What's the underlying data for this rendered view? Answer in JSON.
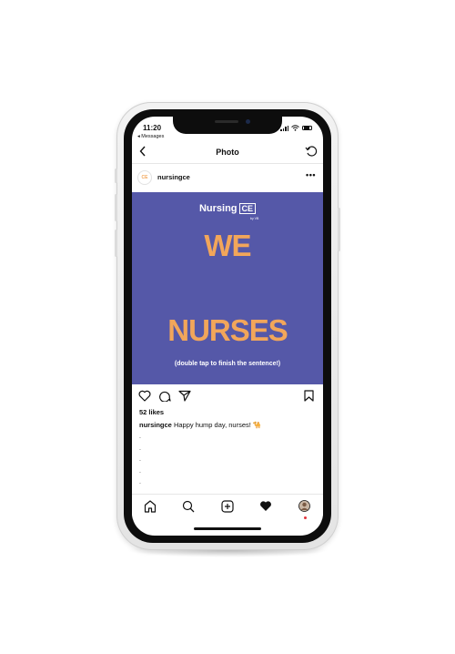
{
  "status_bar": {
    "time": "11:20",
    "back_app": "◂ Messages"
  },
  "nav": {
    "title": "Photo"
  },
  "post": {
    "username": "nursingce",
    "avatar_text": "CE",
    "more": "•••"
  },
  "image": {
    "brand_name": "Nursing",
    "brand_box": "CE",
    "brand_sub": "by VB",
    "line1": "WE",
    "line2": "NURSES",
    "subtitle": "(double tap to finish the sentence!)",
    "background_color": "#5558a8",
    "accent_color": "#f2a65a"
  },
  "engagement": {
    "likes": "52 likes",
    "caption_user": "nursingce",
    "caption_text": "Happy hump day, nurses! 🐪",
    "dots": [
      ".",
      ".",
      ".",
      ".",
      ".",
      "."
    ]
  },
  "tabs": [
    "home-icon",
    "search-icon",
    "add-post-icon",
    "activity-heart-icon",
    "profile-avatar-icon"
  ]
}
